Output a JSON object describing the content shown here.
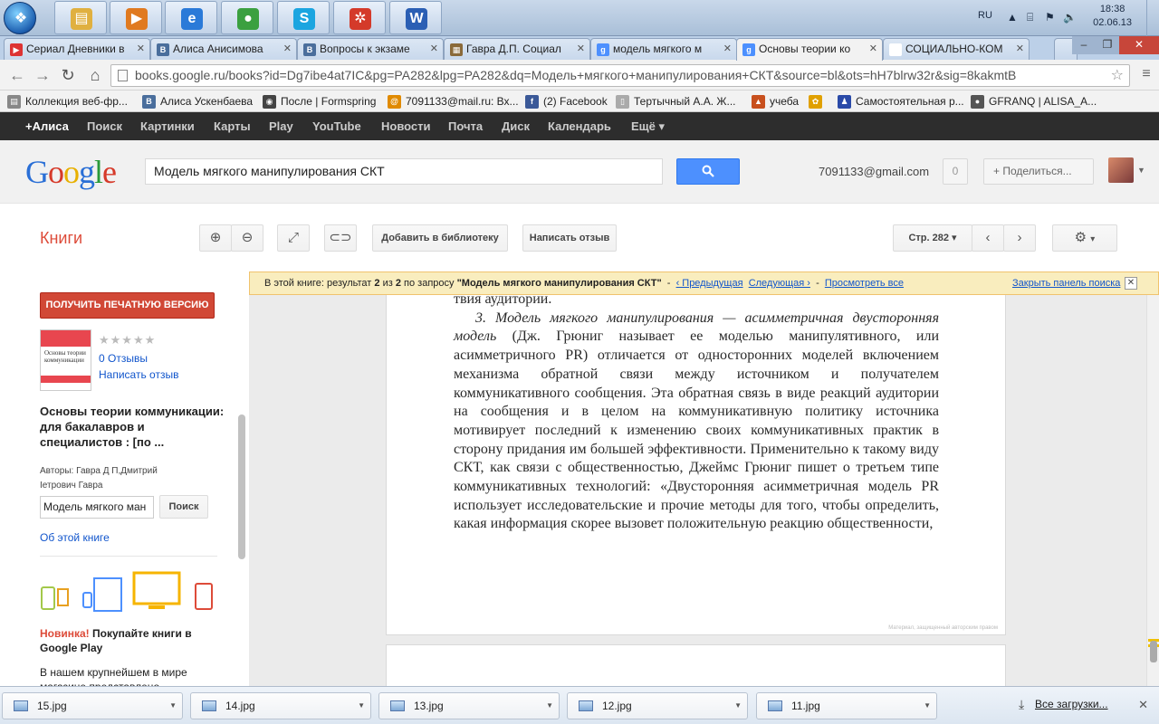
{
  "taskbar": {
    "apps": [
      {
        "name": "explorer",
        "glyph": "▤",
        "color": "#e0b040"
      },
      {
        "name": "media-player",
        "glyph": "▶",
        "color": "#e07a20"
      },
      {
        "name": "internet-explorer",
        "glyph": "e",
        "color": "#2a7ad8"
      },
      {
        "name": "chrome",
        "glyph": "●",
        "color": "#3ba040"
      },
      {
        "name": "skype",
        "glyph": "S",
        "color": "#1ba5e0"
      },
      {
        "name": "app-red",
        "glyph": "✲",
        "color": "#d43a2a"
      },
      {
        "name": "word",
        "glyph": "W",
        "color": "#2b5fb4"
      }
    ],
    "lang": "RU",
    "time": "18:38",
    "date": "02.06.13"
  },
  "tabs": [
    {
      "label": "Сериал Дневники в",
      "fav": "▶",
      "color": "#d33"
    },
    {
      "label": "Алиса Анисимова",
      "fav": "В",
      "color": "#4a6e9c"
    },
    {
      "label": "Вопросы к экзаме",
      "fav": "В",
      "color": "#4a6e9c"
    },
    {
      "label": "Гавра Д.П. Социал",
      "fav": "▦",
      "color": "#8a6a3a"
    },
    {
      "label": "модель мягкого м",
      "fav": "g",
      "color": "#4d90fe"
    },
    {
      "label": "Основы теории ко",
      "fav": "g",
      "color": "#4d90fe"
    },
    {
      "label": "СОЦИАЛЬНО-КОМ",
      "fav": "",
      "color": "#fff"
    }
  ],
  "url": "books.google.ru/books?id=Dg7ibe4at7IC&pg=PA282&lpg=PA282&dq=Модель+мягкого+манипулирования+СКТ&source=bl&ots=hH7blrw32r&sig=8kakmtB",
  "bookmarks": [
    {
      "label": "Коллекция веб-фр...",
      "icon": "▤",
      "color": "#888"
    },
    {
      "label": "Алиса Ускенбаева",
      "icon": "В",
      "color": "#4a6e9c"
    },
    {
      "label": "После | Formspring",
      "icon": "◉",
      "color": "#444"
    },
    {
      "label": "7091133@mail.ru: Вх...",
      "icon": "@",
      "color": "#e08a00"
    },
    {
      "label": "(2) Facebook",
      "icon": "f",
      "color": "#3b5998"
    },
    {
      "label": "Тертычный А.А. Ж...",
      "icon": "▯",
      "color": "#aaa"
    },
    {
      "label": "учеба",
      "icon": "▲",
      "color": "#c8501e"
    },
    {
      "label": "",
      "icon": "✿",
      "color": "#e0a000"
    },
    {
      "label": "Самостоятельная р...",
      "icon": "♟",
      "color": "#2a4aa8"
    },
    {
      "label": "GFRANQ | ALISA_A...",
      "icon": "●",
      "color": "#555"
    }
  ],
  "gbar": [
    "+Алиса",
    "Поиск",
    "Картинки",
    "Карты",
    "Play",
    "YouTube",
    "Новости",
    "Почта",
    "Диск",
    "Календарь",
    "Ещё ▾"
  ],
  "header": {
    "logo": "Google",
    "query": "Модель мягкого манипулирования СКТ",
    "account": "7091133@gmail.com",
    "notifications": "0",
    "share": "+ Поделиться..."
  },
  "books_toolbar": {
    "section": "Книги",
    "add_library": "Добавить в библиотеку",
    "write_review": "Написать отзыв",
    "page": "Стр. 282"
  },
  "notice": {
    "prefix": "В этой книге: результат",
    "current": "2",
    "of": "из",
    "total": "2",
    "by_query": "по запросу",
    "query": "\"Модель мягкого манипулирования СКТ\"",
    "prev": "‹ Предыдущая",
    "next": "Следующая ›",
    "view_all": "Просмотреть все",
    "close": "Закрыть панель поиска"
  },
  "sidebar": {
    "print_version": "ПОЛУЧИТЬ ПЕЧАТНУЮ ВЕРСИЮ",
    "cover_title": "Основы теории коммуникации",
    "stars": "★★★★★",
    "reviews": "0 Отзывы",
    "write_review": "Написать отзыв",
    "book_title": "Основы теории коммуникации: для бакалавров и специалистов : [по ...",
    "authors_line1": "Авторы: Гавра Д П,Дмитрий",
    "authors_line2": "Іетрович Гавра",
    "in_book_query": "Модель мягкого ман",
    "search_btn": "Поиск",
    "about": "Об этой книге",
    "promo_new": "Новинка!",
    "promo_bold": "Покупайте книги в Google Play",
    "promo_text": "В нашем крупнейшем в мире магазине представлено"
  },
  "book_page": {
    "line0": "твия аудитории.",
    "italic_title": "3. Модель мягкого манипулирования — асимметричная двусторонняя модель",
    "body": " (Дж. Грюниг называет ее моделью манипулятивного, или асимметричного PR) отличается от односторонних моделей включением механизма обратной связи между источником и получателем коммуникативного сообщения. Эта обратная связь в виде реакций аудитории на сообщения и в целом на коммуникативную политику источника мотивирует последний к изменению своих коммуникативных практик в сторону придания им большей эффективности. Применительно к такому виду СКТ, как связи с общественностью, Джеймс Грюниг пишет о третьем типе коммуникативных технологий: «Двусторонняя асимметричная модель PR использует исследовательские и прочие методы для того, чтобы определить, какая информация скорее вызовет положительную реакцию общественности,",
    "copyright": "Материал, защищенный авторским правом"
  },
  "downloads": {
    "items": [
      "15.jpg",
      "14.jpg",
      "13.jpg",
      "12.jpg",
      "11.jpg"
    ],
    "all": "Все загрузки..."
  }
}
